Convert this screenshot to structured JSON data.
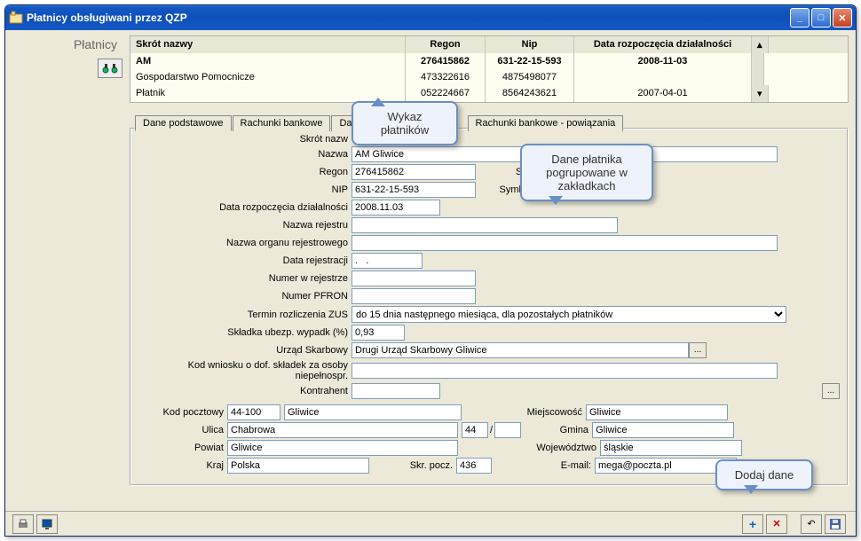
{
  "window": {
    "title": "Płatnicy obsługiwani przez QZP"
  },
  "sidebar": {
    "title": "Płatnicy"
  },
  "grid": {
    "headers": {
      "skrot": "Skrót nazwy",
      "regon": "Regon",
      "nip": "Nip",
      "data": "Data rozpoczęcia działalności"
    },
    "rows": [
      {
        "skrot": "AM",
        "regon": "276415862",
        "nip": "631-22-15-593",
        "data": "2008-11-03",
        "selected": true
      },
      {
        "skrot": "Gospodarstwo Pomocnicze",
        "regon": "473322616",
        "nip": "4875498077",
        "data": ""
      },
      {
        "skrot": "Płatnik",
        "regon": "052224667",
        "nip": "8564243621",
        "data": "2007-04-01"
      }
    ]
  },
  "tabs": {
    "t0": "Dane podstawowe",
    "t1": "Rachunki bankowe",
    "t2": "Da",
    "t3": "Rachunki bankowe - powiązania"
  },
  "form": {
    "labels": {
      "skrot": "Skrót nazw",
      "nazwa": "Nazwa",
      "regon": "Regon",
      "sprzeda": "Sprzeda",
      "nip": "NIP",
      "symbol_vat": "Symbol VAT",
      "data_rozp": "Data rozpoczęcia działalności",
      "nazwa_rej": "Nazwa rejestru",
      "nazwa_org": "Nazwa organu rejestrowego",
      "data_rej": "Data rejestracji",
      "numer_rej": "Numer w rejestrze",
      "numer_pfron": "Numer PFRON",
      "termin_zus": "Termin rozliczenia ZUS",
      "skladka": "Składka ubezp. wypadk (%)",
      "urzad_sk": "Urząd Skarbowy",
      "kod_wn": "Kod wniosku o dof. składek za osoby niepełnospr.",
      "kontrahent": "Kontrahent",
      "kod_poczt": "Kod pocztowy",
      "miejsc": "Miejscowość",
      "ulica": "Ulica",
      "gmina": "Gmina",
      "powiat": "Powiat",
      "woj": "Województwo",
      "kraj": "Kraj",
      "skr_pocz": "Skr. pocz.",
      "email": "E-mail:"
    },
    "values": {
      "skrot": "",
      "nazwa": "AM Gliwice",
      "regon": "276415862",
      "nip": "631-22-15-593",
      "data_rozp": "2008.11.03",
      "nazwa_rej": "",
      "nazwa_org": "",
      "data_rej": ".   .",
      "numer_rej": "",
      "numer_pfron": "",
      "termin_zus": "do 15 dnia następnego miesiąca, dla pozostałych płatników",
      "skladka": "0,93",
      "urzad_sk": "Drugi Urząd Skarbowy Gliwice",
      "kod_wn": "",
      "kontrahent": "",
      "kod_poczt": "44-100",
      "kod_poczt_city": "Gliwice",
      "miejsc": "Gliwice",
      "ulica": "Chabrowa",
      "ulica_nr": "44",
      "ulica_slash": "/",
      "gmina": "Gliwice",
      "powiat": "Gliwice",
      "woj": "śląskie",
      "kraj": "Polska",
      "skr_pocz": "436",
      "email": "mega@poczta.pl"
    }
  },
  "callouts": {
    "c1": "Wykaz płatników",
    "c2": "Dane płatnika pogrupowane w zakładkach",
    "c3": "Dodaj dane"
  }
}
